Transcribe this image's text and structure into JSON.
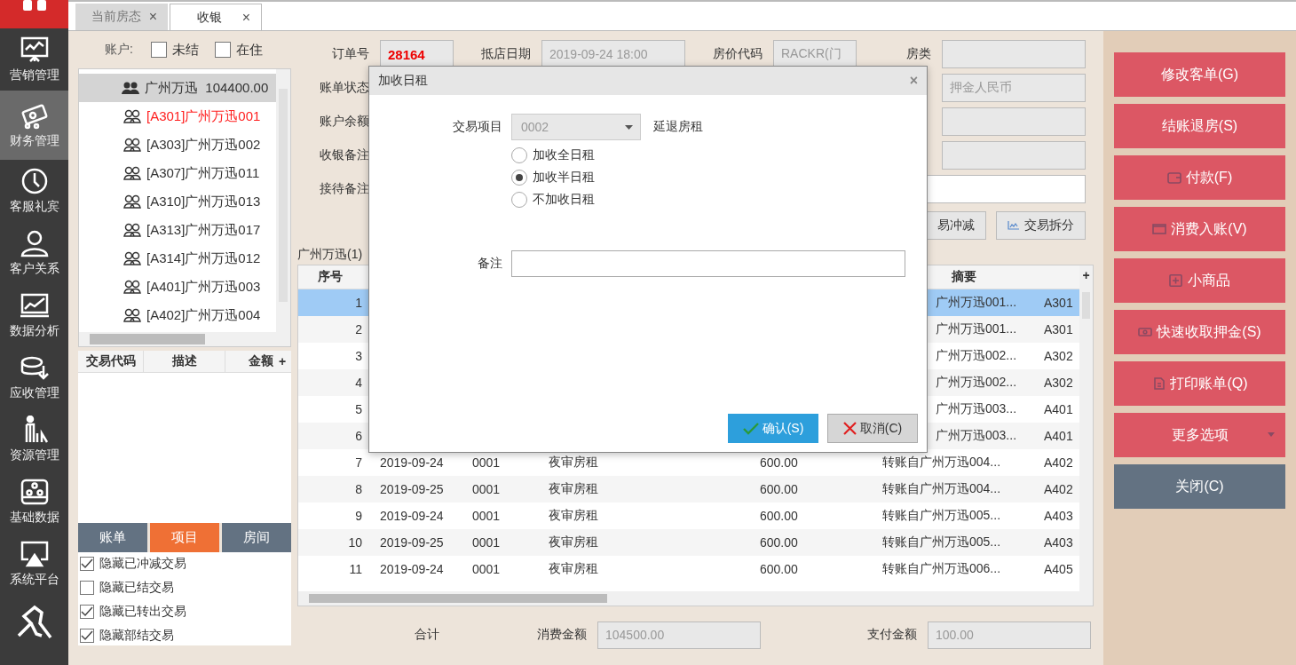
{
  "nav": {
    "items": [
      {
        "label": "营销管理",
        "selected": false
      },
      {
        "label": "财务管理",
        "selected": true
      },
      {
        "label": "客服礼宾",
        "selected": false
      },
      {
        "label": "客户关系",
        "selected": false
      },
      {
        "label": "数据分析",
        "selected": false
      },
      {
        "label": "应收管理",
        "selected": false
      },
      {
        "label": "资源管理",
        "selected": false
      },
      {
        "label": "基础数据",
        "selected": false
      },
      {
        "label": "系统平台",
        "selected": false
      }
    ]
  },
  "tabs": [
    {
      "label": "当前房态",
      "close": "×",
      "selected": false
    },
    {
      "label": "收银",
      "close": "×",
      "selected": true
    }
  ],
  "account_filter": {
    "label": "账户:",
    "options": [
      {
        "label": "未结",
        "checked": false
      },
      {
        "label": "在住",
        "checked": false
      }
    ]
  },
  "account_tree": [
    {
      "label": "广州万迅",
      "amount": "104400.00",
      "selected": true,
      "children": [
        {
          "label": "[A301]广州万迅001",
          "color": "#ff2020"
        },
        {
          "label": "[A303]广州万迅002",
          "color": "#333333"
        },
        {
          "label": "[A307]广州万迅011",
          "color": "#333333"
        },
        {
          "label": "[A310]广州万迅013",
          "color": "#333333"
        },
        {
          "label": "[A313]广州万迅017",
          "color": "#333333"
        },
        {
          "label": "[A314]广州万迅012",
          "color": "#333333"
        },
        {
          "label": "[A401]广州万迅003",
          "color": "#333333"
        },
        {
          "label": "[A402]广州万迅004",
          "color": "#333333"
        }
      ]
    }
  ],
  "transaction_grid": {
    "columns": [
      "交易代码",
      "描述",
      "金额"
    ],
    "add": "+"
  },
  "view_tabs": [
    {
      "label": "账单",
      "selected": false
    },
    {
      "label": "项目",
      "selected": true
    },
    {
      "label": "房间",
      "selected": false
    }
  ],
  "hide_options": [
    {
      "label": "隐藏已冲减交易",
      "checked": true
    },
    {
      "label": "隐藏已结交易",
      "checked": false
    },
    {
      "label": "隐藏已转出交易",
      "checked": true
    },
    {
      "label": "隐藏部结交易",
      "checked": true
    }
  ],
  "order_form": {
    "order_no": {
      "label": "订单号",
      "value": "28164"
    },
    "arrival": {
      "label": "抵店日期",
      "value": "2019-09-24 18:00"
    },
    "rate_code": {
      "label": "房价代码",
      "value": "RACKR(门"
    },
    "room_type": {
      "label": "房类"
    },
    "bill_status": {
      "label": "账单状态"
    },
    "deposit_type": {
      "value": "押金人民币"
    },
    "balance": {
      "label": "账户余额"
    },
    "cashier_note": {
      "label": "收银备注"
    },
    "reception_note": {
      "label": "接待备注"
    }
  },
  "actions": [
    {
      "label": "易冲减",
      "kind": "plain"
    },
    {
      "label": "交易拆分",
      "kind": "split"
    }
  ],
  "ledger": {
    "title": "广州万迅(1)",
    "columns": {
      "no": "序号",
      "summary": "摘要"
    },
    "add": "+",
    "rows": [
      {
        "no": "1",
        "summary": "广州万迅001...",
        "room": "A301",
        "selected": true
      },
      {
        "no": "2",
        "summary": "广州万迅001...",
        "room": "A301",
        "selected": false
      },
      {
        "no": "3",
        "summary": "广州万迅002...",
        "room": "A302",
        "selected": false
      },
      {
        "no": "4",
        "summary": "广州万迅002...",
        "room": "A302",
        "selected": false
      },
      {
        "no": "5",
        "summary": "广州万迅003...",
        "room": "A401",
        "selected": false
      },
      {
        "no": "6",
        "summary": "广州万迅003...",
        "room": "A401",
        "selected": false
      },
      {
        "no": "7",
        "date": "2019-09-24",
        "code": "0001",
        "desc": "夜审房租",
        "amount": "600.00",
        "summary": "转账自广州万迅004...",
        "room": "A402",
        "selected": false
      },
      {
        "no": "8",
        "date": "2019-09-25",
        "code": "0001",
        "desc": "夜审房租",
        "amount": "600.00",
        "summary": "转账自广州万迅004...",
        "room": "A402",
        "selected": false
      },
      {
        "no": "9",
        "date": "2019-09-24",
        "code": "0001",
        "desc": "夜审房租",
        "amount": "600.00",
        "summary": "转账自广州万迅005...",
        "room": "A403",
        "selected": false
      },
      {
        "no": "10",
        "date": "2019-09-25",
        "code": "0001",
        "desc": "夜审房租",
        "amount": "600.00",
        "summary": "转账自广州万迅005...",
        "room": "A403",
        "selected": false
      },
      {
        "no": "11",
        "date": "2019-09-24",
        "code": "0001",
        "desc": "夜审房租",
        "amount": "600.00",
        "summary": "转账自广州万迅006...",
        "room": "A405",
        "selected": false
      }
    ]
  },
  "totals": {
    "label": "合计",
    "consumption": {
      "label": "消费金额",
      "value": "104500.00"
    },
    "payment": {
      "label": "支付金额",
      "value": "100.00"
    }
  },
  "side_buttons": [
    {
      "label": "修改客单(G)",
      "kind": "plain"
    },
    {
      "label": "结账退房(S)",
      "kind": "plain"
    },
    {
      "label": "付款(F)",
      "kind": "wallet"
    },
    {
      "label": "消费入账(V)",
      "kind": "bill"
    },
    {
      "label": "小商品",
      "kind": "plus"
    },
    {
      "label": "快速收取押金(S)",
      "kind": "cash"
    },
    {
      "label": "打印账单(Q)",
      "kind": "print"
    },
    {
      "label": "更多选项",
      "kind": "menu"
    },
    {
      "label": "关闭(C)",
      "kind": "close"
    }
  ],
  "dialog": {
    "title": "加收日租",
    "close": "×",
    "item": {
      "label": "交易项目",
      "value": "0002",
      "description": "延退房租"
    },
    "options": [
      {
        "label": "加收全日租",
        "selected": false
      },
      {
        "label": "加收半日租",
        "selected": true
      },
      {
        "label": "不加收日租",
        "selected": false
      }
    ],
    "note": {
      "label": "备注"
    },
    "buttons": [
      {
        "label": "确认(S)",
        "kind": "confirm"
      },
      {
        "label": "取消(C)",
        "kind": "cancel"
      }
    ]
  }
}
